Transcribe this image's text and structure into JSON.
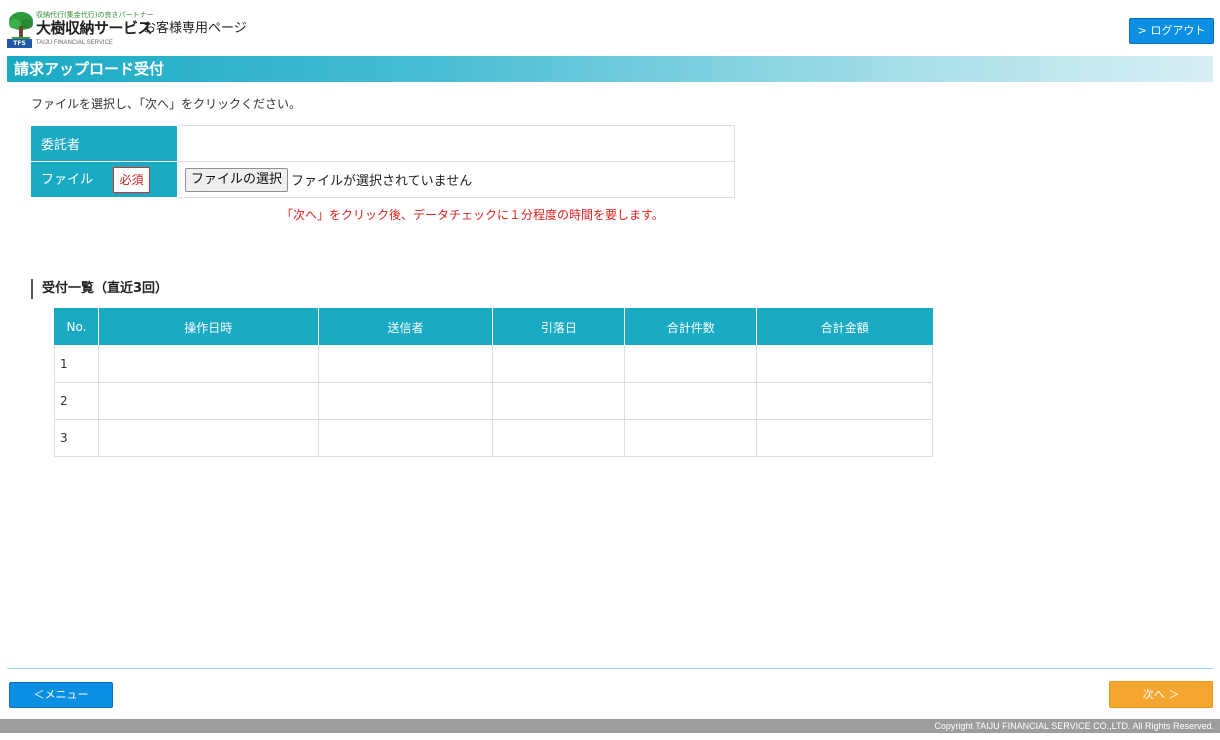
{
  "header": {
    "logo_tagline": "収納代行(集金代行)の良きパートナー",
    "logo_name": "大樹収納サービス",
    "logo_badge": "TFS",
    "logo_english": "TAIJU FINANCIAL SERVICE",
    "page_label": "お客様専用ページ",
    "logout_label": "> ログアウト"
  },
  "title": "請求アップロード受付",
  "instruction": "ファイルを選択し、「次へ」をクリックください。",
  "form": {
    "consignor_label": "委託者",
    "consignor_value": "",
    "file_label": "ファイル",
    "required_badge": "必須",
    "file_button_label": "ファイルの選択",
    "file_status": "ファイルが選択されていません"
  },
  "notice": "「次へ」をクリック後、データチェックに１分程度の時間を要します。",
  "history": {
    "heading": "受付一覧（直近3回）",
    "columns": [
      "No.",
      "操作日時",
      "送信者",
      "引落日",
      "合計件数",
      "合計金額"
    ],
    "rows": [
      [
        "1",
        "",
        "",
        "",
        "",
        ""
      ],
      [
        "2",
        "",
        "",
        "",
        "",
        ""
      ],
      [
        "3",
        "",
        "",
        "",
        "",
        ""
      ]
    ]
  },
  "footer": {
    "menu_label": "＜メニュー",
    "next_label": "次へ ＞",
    "copyright": "Copyright TAIJU FINANCIAL SERVICE CO.,LTD. All Rights Reserved."
  },
  "colors": {
    "accent_teal": "#1aaac4",
    "button_blue": "#0b8fe3",
    "button_orange": "#f5a630",
    "notice_red": "#e02020"
  }
}
